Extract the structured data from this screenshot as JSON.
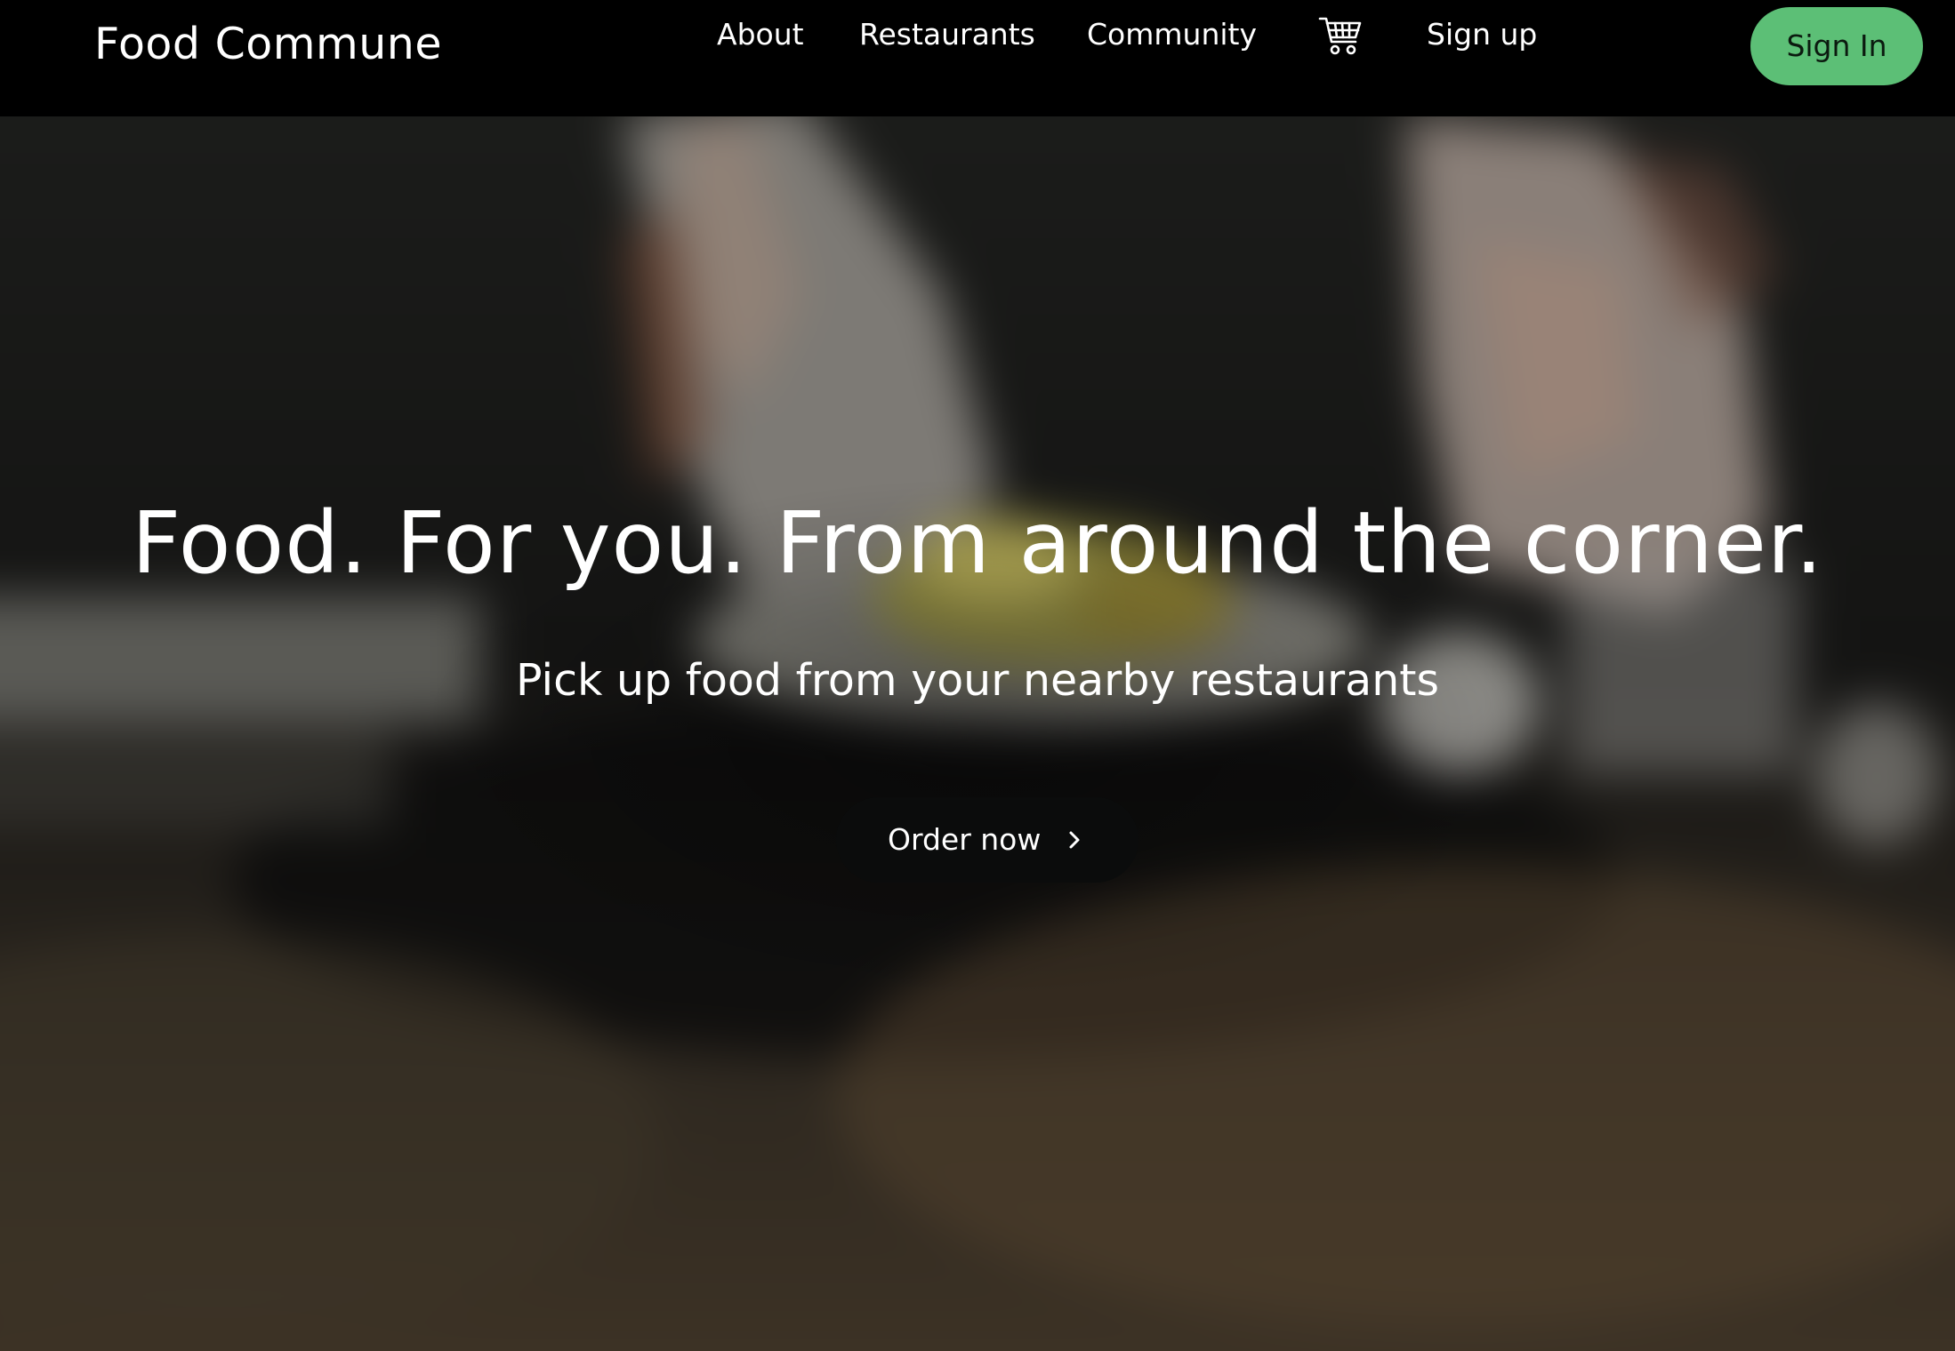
{
  "navbar": {
    "brand": "Food Commune",
    "links": {
      "about": "About",
      "restaurants": "Restaurants",
      "community": "Community",
      "signup": "Sign up"
    },
    "cart_icon": "shopping-cart-icon",
    "signin_label": "Sign In"
  },
  "hero": {
    "title": "Food. For you. From around the corner.",
    "subtitle": "Pick up food from your nearby restaurants",
    "cta_label": "Order now",
    "cta_icon": "chevron-right-icon"
  },
  "colors": {
    "navbar_bg": "#000000",
    "signin_bg": "#5cbf76",
    "cta_bg": "#0b0c0c",
    "text": "#ffffff"
  }
}
